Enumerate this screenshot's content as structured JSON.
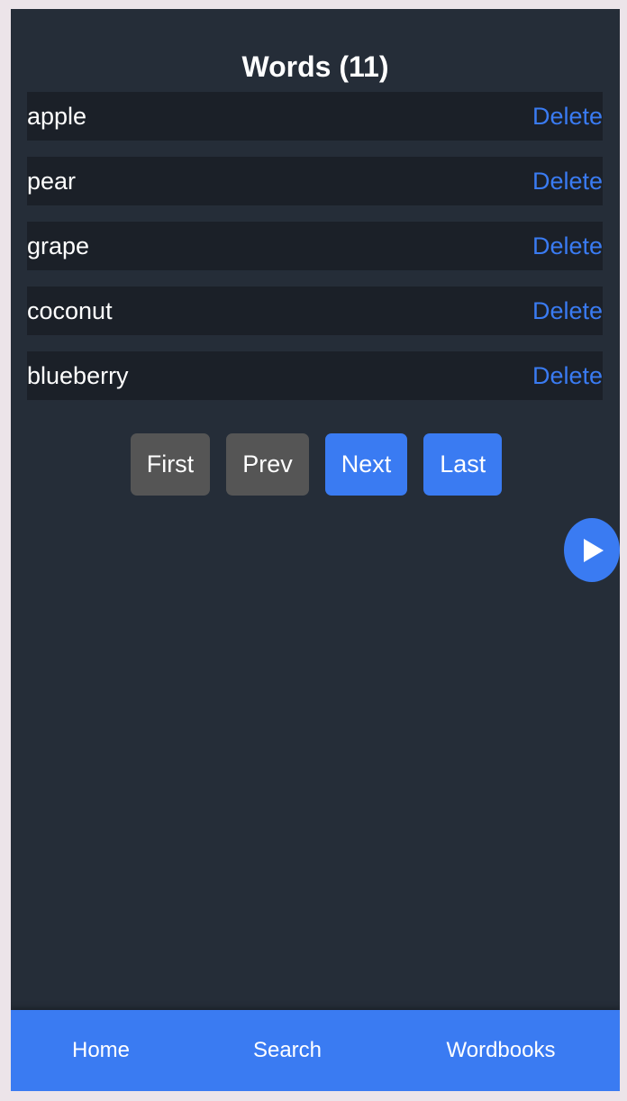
{
  "header": {
    "title": "Words (11)"
  },
  "words": [
    {
      "word": "apple",
      "action": "Delete"
    },
    {
      "word": "pear",
      "action": "Delete"
    },
    {
      "word": "grape",
      "action": "Delete"
    },
    {
      "word": "coconut",
      "action": "Delete"
    },
    {
      "word": "blueberry",
      "action": "Delete"
    }
  ],
  "pagination": {
    "first": "First",
    "prev": "Prev",
    "next": "Next",
    "last": "Last"
  },
  "fab": {
    "icon": "play-icon"
  },
  "bottom_nav": {
    "home": "Home",
    "search": "Search",
    "wordbooks": "Wordbooks"
  },
  "colors": {
    "background": "#252d38",
    "row_background": "#1b2028",
    "accent": "#3a7bf2",
    "disabled_button": "#555555",
    "outer_frame": "#ece4e9"
  }
}
